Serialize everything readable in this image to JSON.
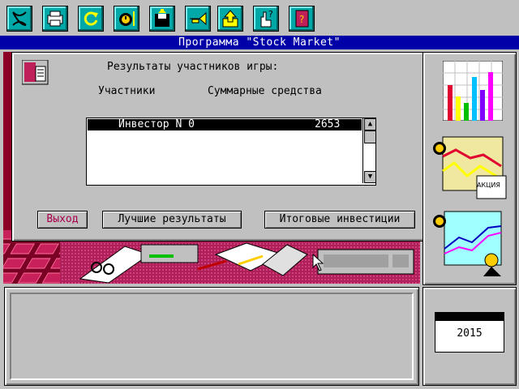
{
  "toolbar": {
    "buttons": [
      {
        "name": "dna-icon"
      },
      {
        "name": "printer-icon"
      },
      {
        "name": "refresh-icon"
      },
      {
        "name": "clock-icon"
      },
      {
        "name": "floppy-disk-icon"
      },
      {
        "name": "trumpet-icon"
      },
      {
        "name": "export-icon"
      },
      {
        "name": "hand-help-icon"
      },
      {
        "name": "book-icon"
      }
    ]
  },
  "window": {
    "title": "Программа \"Stock Market\""
  },
  "dialog": {
    "heading": "Результаты участников игры:",
    "col_participants": "Участники",
    "col_total": "Суммарные средства",
    "rows": [
      {
        "name": "Инвестор N 0",
        "value": "2653"
      }
    ],
    "buttons": {
      "exit": "Выход",
      "best": "Лучшие результаты",
      "final": "Итоговые инвестиции"
    }
  },
  "side": {
    "stock_card_text": "АКЦИЯ",
    "calendar_year": "2015"
  },
  "colors": {
    "toolbar_button": "#00a8a8",
    "title_bar": "#0000a8",
    "selection": "#000000",
    "exit_text": "#a8004c"
  }
}
